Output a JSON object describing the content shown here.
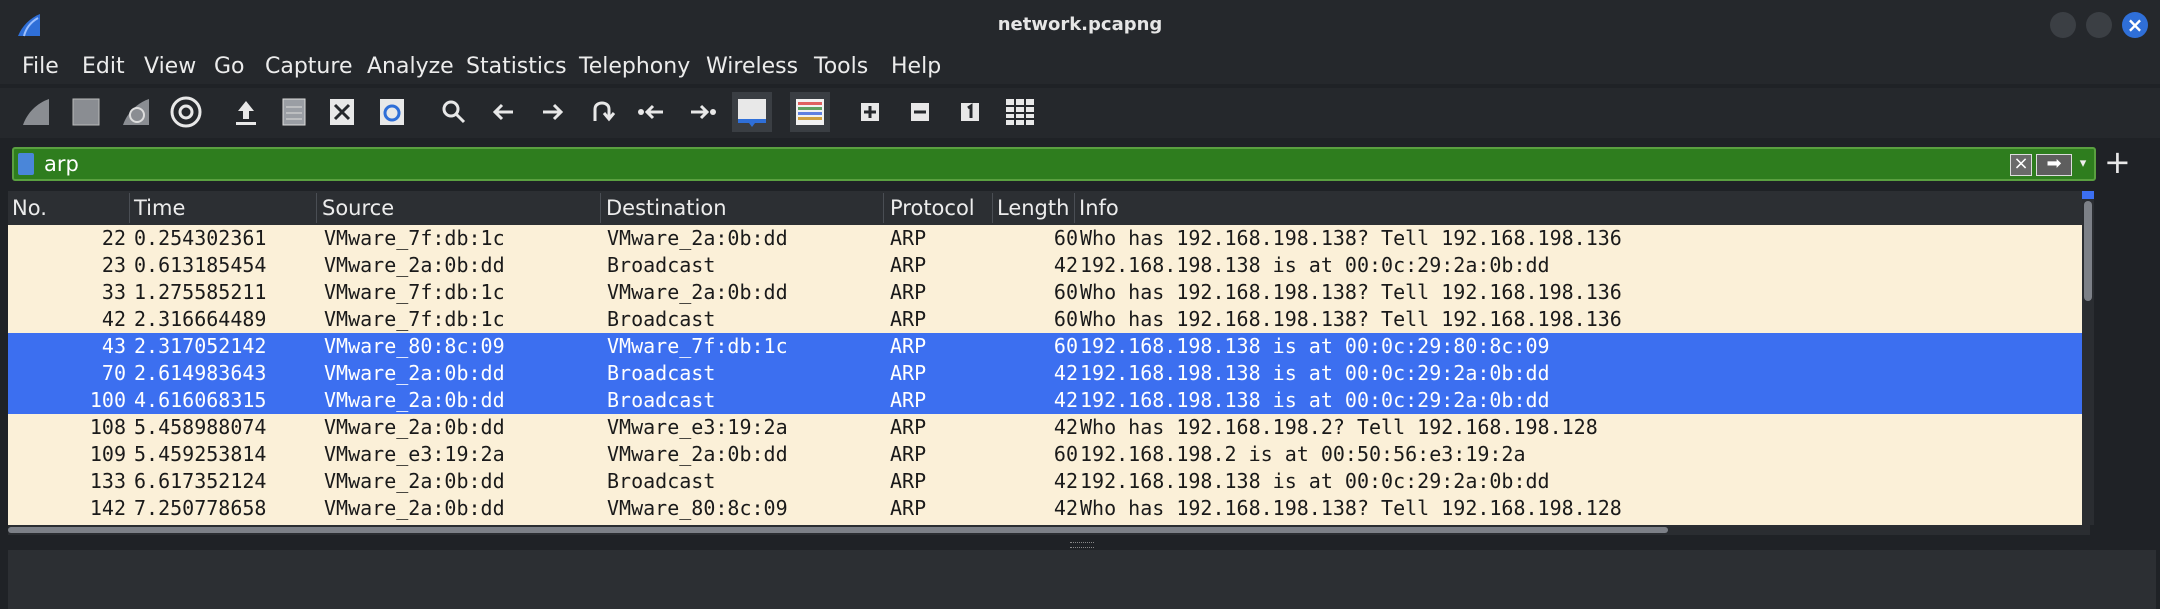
{
  "window": {
    "title": "network.pcapng"
  },
  "menu": [
    "File",
    "Edit",
    "View",
    "Go",
    "Capture",
    "Analyze",
    "Statistics",
    "Telephony",
    "Wireless",
    "Tools",
    "Help"
  ],
  "toolbar": {
    "icons": [
      "start-capture-icon",
      "stop-capture-icon",
      "restart-capture-icon",
      "capture-options-icon",
      "open-file-icon",
      "save-file-icon",
      "close-file-icon",
      "reload-file-icon",
      "find-packet-icon",
      "go-back-icon",
      "go-forward-icon",
      "go-to-packet-icon",
      "go-first-icon",
      "go-last-icon",
      "autoscroll-icon",
      "colorize-icon",
      "zoom-in-icon",
      "zoom-out-icon",
      "normal-size-icon",
      "resize-columns-icon"
    ]
  },
  "filter": {
    "value": "arp"
  },
  "columns": [
    "No.",
    "Time",
    "Source",
    "Destination",
    "Protocol",
    "Length",
    "Info"
  ],
  "packets": [
    {
      "no": "22",
      "time": "0.254302361",
      "src": "VMware_7f:db:1c",
      "dst": "VMware_2a:0b:dd",
      "proto": "ARP",
      "len": "60",
      "info": "Who has 192.168.198.138? Tell 192.168.198.136",
      "selected": false
    },
    {
      "no": "23",
      "time": "0.613185454",
      "src": "VMware_2a:0b:dd",
      "dst": "Broadcast",
      "proto": "ARP",
      "len": "42",
      "info": "192.168.198.138 is at 00:0c:29:2a:0b:dd",
      "selected": false
    },
    {
      "no": "33",
      "time": "1.275585211",
      "src": "VMware_7f:db:1c",
      "dst": "VMware_2a:0b:dd",
      "proto": "ARP",
      "len": "60",
      "info": "Who has 192.168.198.138? Tell 192.168.198.136",
      "selected": false
    },
    {
      "no": "42",
      "time": "2.316664489",
      "src": "VMware_7f:db:1c",
      "dst": "Broadcast",
      "proto": "ARP",
      "len": "60",
      "info": "Who has 192.168.198.138? Tell 192.168.198.136",
      "selected": false
    },
    {
      "no": "43",
      "time": "2.317052142",
      "src": "VMware_80:8c:09",
      "dst": "VMware_7f:db:1c",
      "proto": "ARP",
      "len": "60",
      "info": "192.168.198.138 is at 00:0c:29:80:8c:09",
      "selected": true
    },
    {
      "no": "70",
      "time": "2.614983643",
      "src": "VMware_2a:0b:dd",
      "dst": "Broadcast",
      "proto": "ARP",
      "len": "42",
      "info": "192.168.198.138 is at 00:0c:29:2a:0b:dd",
      "selected": true
    },
    {
      "no": "100",
      "time": "4.616068315",
      "src": "VMware_2a:0b:dd",
      "dst": "Broadcast",
      "proto": "ARP",
      "len": "42",
      "info": "192.168.198.138 is at 00:0c:29:2a:0b:dd",
      "selected": true
    },
    {
      "no": "108",
      "time": "5.458988074",
      "src": "VMware_2a:0b:dd",
      "dst": "VMware_e3:19:2a",
      "proto": "ARP",
      "len": "42",
      "info": "Who has 192.168.198.2? Tell 192.168.198.128",
      "selected": false
    },
    {
      "no": "109",
      "time": "5.459253814",
      "src": "VMware_e3:19:2a",
      "dst": "VMware_2a:0b:dd",
      "proto": "ARP",
      "len": "60",
      "info": "192.168.198.2 is at 00:50:56:e3:19:2a",
      "selected": false
    },
    {
      "no": "133",
      "time": "6.617352124",
      "src": "VMware_2a:0b:dd",
      "dst": "Broadcast",
      "proto": "ARP",
      "len": "42",
      "info": "192.168.198.138 is at 00:0c:29:2a:0b:dd",
      "selected": false
    },
    {
      "no": "142",
      "time": "7.250778658",
      "src": "VMware_2a:0b:dd",
      "dst": "VMware_80:8c:09",
      "proto": "ARP",
      "len": "42",
      "info": "Who has 192.168.198.138? Tell 192.168.198.128",
      "selected": false
    }
  ],
  "colors": {
    "row_bg": "#fbf0d8",
    "selected_bg": "#3c6ff0",
    "filter_ok": "#2e7d1e"
  }
}
